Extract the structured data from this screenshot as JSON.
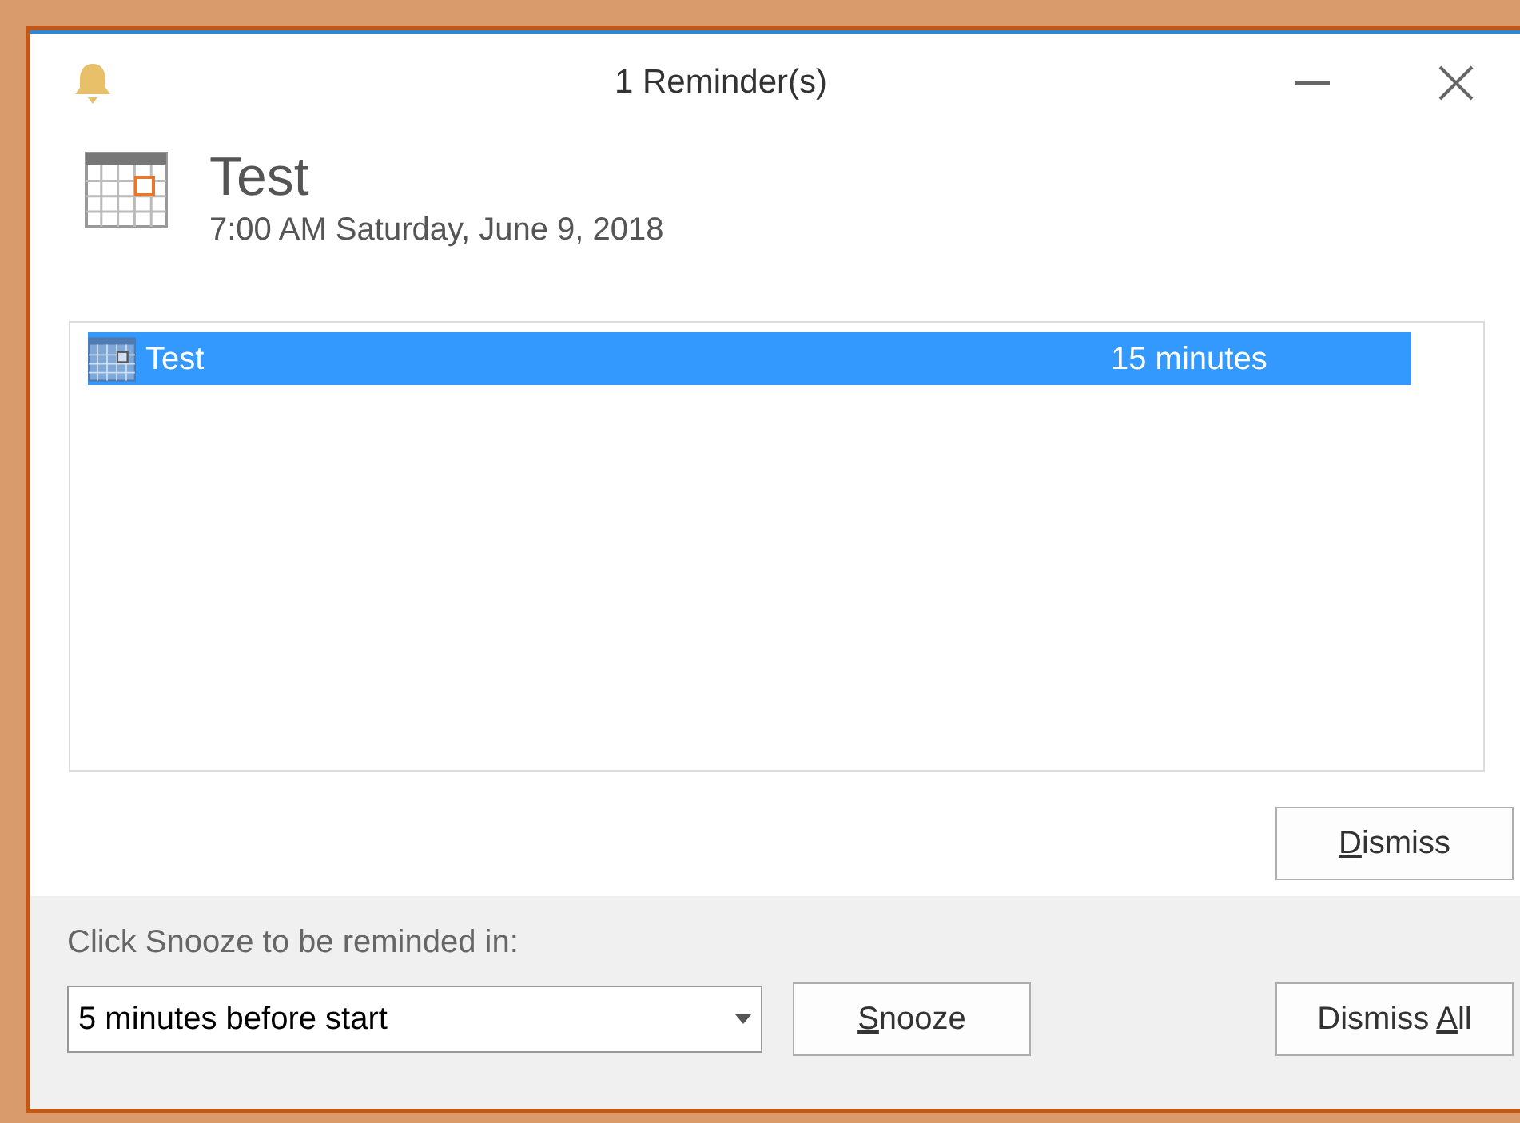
{
  "window": {
    "title": "1 Reminder(s)"
  },
  "reminder": {
    "subject": "Test",
    "when": "7:00 AM Saturday, June 9, 2018"
  },
  "list": {
    "rows": [
      {
        "subject": "Test",
        "due_in": "15 minutes",
        "selected": true
      }
    ]
  },
  "dismiss_button": {
    "key": "D",
    "after": "ismiss"
  },
  "snooze": {
    "label": "Click Snooze to be reminded in:",
    "value": "5 minutes before start"
  },
  "snooze_button": {
    "key": "S",
    "after": "nooze"
  },
  "dismiss_all_button": {
    "before": "Dismiss ",
    "key": "A",
    "after": "ll"
  }
}
